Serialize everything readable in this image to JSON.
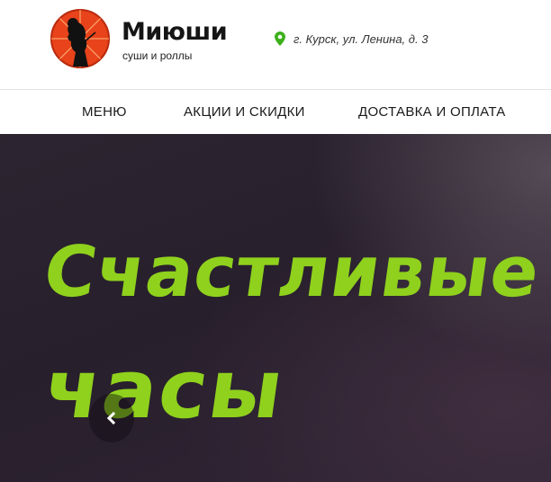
{
  "header": {
    "logo": {
      "title": "Миюши",
      "subtitle": "суши и роллы",
      "emblem_icon": "geisha-umbrella-emblem",
      "emblem_color": "#e8431a"
    },
    "address": {
      "icon": "map-pin-icon",
      "icon_color": "#3db01c",
      "text": "г. Курск, ул. Ленина, д. 3"
    }
  },
  "nav": {
    "items": [
      {
        "label": "МЕНЮ"
      },
      {
        "label": "АКЦИИ И СКИДКИ"
      },
      {
        "label": "ДОСТАВКА И ОПЛАТА"
      }
    ]
  },
  "hero": {
    "headline_line1": "Счастливые",
    "headline_line2": "часы",
    "headline_color": "#8fd11d",
    "prev_icon": "chevron-left-icon"
  }
}
